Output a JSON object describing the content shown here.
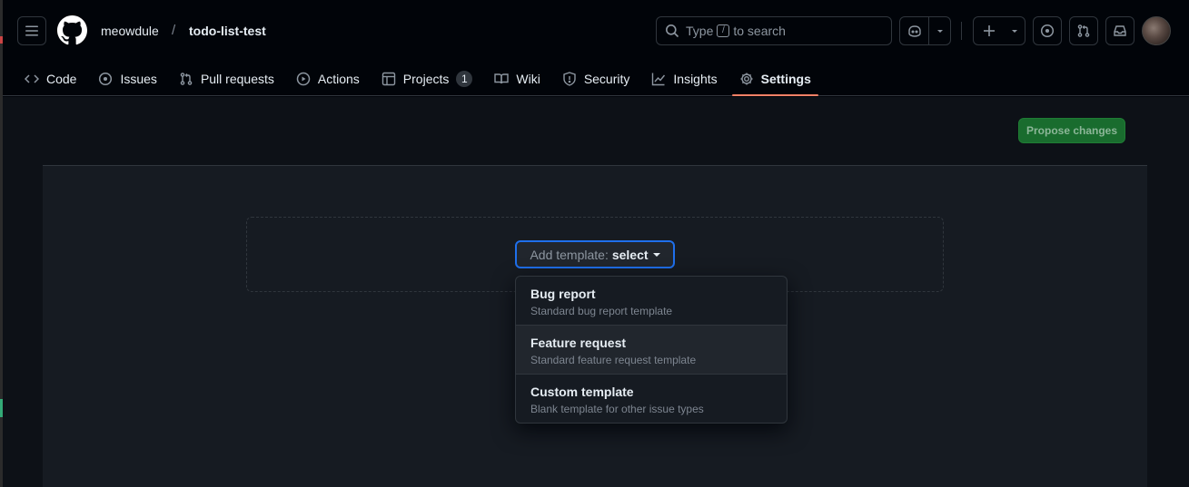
{
  "header": {
    "owner": "meowdule",
    "separator": "/",
    "repo": "todo-list-test",
    "search": {
      "text_before": "Type",
      "key": "/",
      "text_after": "to search"
    }
  },
  "tabs": [
    {
      "label": "Code",
      "icon": "code-icon"
    },
    {
      "label": "Issues",
      "icon": "issue-opened-icon"
    },
    {
      "label": "Pull requests",
      "icon": "git-pull-request-icon"
    },
    {
      "label": "Actions",
      "icon": "play-icon"
    },
    {
      "label": "Projects",
      "icon": "table-icon",
      "counter": "1"
    },
    {
      "label": "Wiki",
      "icon": "book-icon"
    },
    {
      "label": "Security",
      "icon": "shield-icon"
    },
    {
      "label": "Insights",
      "icon": "graph-icon"
    },
    {
      "label": "Settings",
      "icon": "gear-icon",
      "selected": true
    }
  ],
  "main": {
    "propose_button": "Propose changes",
    "template_button": {
      "prefix": "Add template:",
      "value": "select"
    },
    "menu": [
      {
        "title": "Bug report",
        "desc": "Standard bug report template"
      },
      {
        "title": "Feature request",
        "desc": "Standard feature request template"
      },
      {
        "title": "Custom template",
        "desc": "Blank template for other issue types"
      }
    ]
  },
  "colors": {
    "accent_underline": "#f78166",
    "focus_border": "#1f6feb",
    "propose_bg": "#196c2e"
  }
}
